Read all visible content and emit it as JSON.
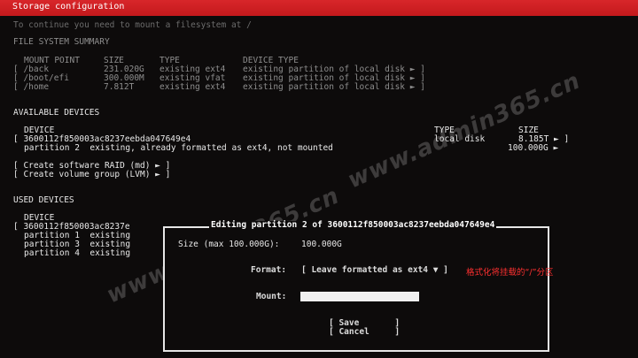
{
  "title": "Storage configuration",
  "intro": "To continue you need to mount a filesystem at /",
  "fs_summary": {
    "heading": "FILE SYSTEM SUMMARY",
    "headers": {
      "mount": "MOUNT POINT",
      "size": "SIZE",
      "type": "TYPE",
      "device_type": "DEVICE TYPE"
    },
    "rows": [
      {
        "mount": "[ /back",
        "size": "231.020G",
        "type": "existing ext4",
        "device_type": "existing partition of local disk ► ]"
      },
      {
        "mount": "[ /boot/efi",
        "size": "300.000M",
        "type": "existing vfat",
        "device_type": "existing partition of local disk ► ]"
      },
      {
        "mount": "[ /home",
        "size": "7.812T",
        "type": "existing ext4",
        "device_type": "existing partition of local disk ► ]"
      }
    ]
  },
  "available": {
    "heading": "AVAILABLE DEVICES",
    "headers": {
      "device": "DEVICE",
      "type": "TYPE",
      "size": "SIZE"
    },
    "disk": {
      "device": "[ 3600112f850003ac8237eebda047649e4",
      "type": "local disk",
      "size": "8.185T ► ]"
    },
    "partition": {
      "label": "partition 2  existing, already formatted as ext4, not mounted",
      "size": "100.000G ►"
    },
    "actions": [
      "[ Create software RAID (md) ► ]",
      "[ Create volume group (LVM) ► ]"
    ]
  },
  "used": {
    "heading": "USED DEVICES",
    "header_device": "DEVICE",
    "disk": "[ 3600112f850003ac8237e",
    "partitions": [
      "partition 1  existing",
      "partition 3  existing",
      "partition 4  existing"
    ]
  },
  "dialog": {
    "title": "Editing partition 2 of 3600112f850003ac8237eebda047649e4",
    "size_label": "Size (max 100.000G):",
    "size_value": "100.000G",
    "format_label": "Format:",
    "format_value": "[ Leave formatted as ext4 ▼ ]",
    "format_annotation": "格式化将挂载的“/”分区",
    "mount_label": "Mount:",
    "mount_value": "",
    "save": "[ Save       ]",
    "cancel": "[ Cancel     ]"
  },
  "watermark": "www.admin365.cn"
}
